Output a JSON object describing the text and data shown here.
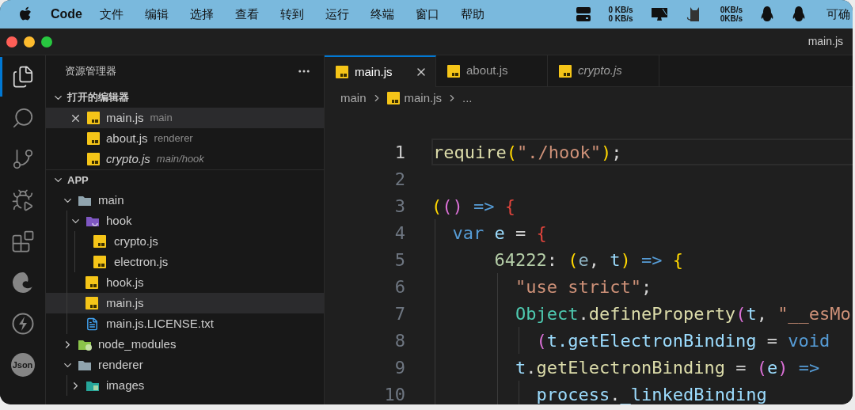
{
  "menu_bar": {
    "app_name": "Code",
    "menus": [
      "文件",
      "编辑",
      "选择",
      "查看",
      "转到",
      "运行",
      "终端",
      "窗口",
      "帮助"
    ],
    "status_items": [
      {
        "kind": "drive"
      },
      {
        "kind": "speed",
        "lines": [
          "0 KB/s",
          "0 KB/s"
        ]
      },
      {
        "kind": "monitor"
      },
      {
        "kind": "cat"
      },
      {
        "kind": "speed",
        "lines": [
          "0KB/s",
          "0KB/s"
        ]
      },
      {
        "kind": "penguin"
      },
      {
        "kind": "penguin"
      }
    ],
    "trailing_text": "可确"
  },
  "window": {
    "title": "main.js"
  },
  "activity_bar": [
    {
      "kind": "explorer",
      "selected": true
    },
    {
      "kind": "search",
      "selected": false
    },
    {
      "kind": "source-control",
      "selected": false
    },
    {
      "kind": "run-debug",
      "selected": false
    },
    {
      "kind": "extensions",
      "selected": false
    },
    {
      "kind": "browser",
      "selected": false
    },
    {
      "kind": "lightning",
      "selected": false
    },
    {
      "kind": "json",
      "label": "Json",
      "selected": false
    }
  ],
  "sidebar": {
    "title": "资源管理器",
    "open_editors": {
      "title": "打开的编辑器",
      "expanded": true,
      "items": [
        {
          "name": "main.js",
          "description": "main",
          "kind": "js",
          "selected": true,
          "preview": false
        },
        {
          "name": "about.js",
          "description": "renderer",
          "kind": "js",
          "selected": false,
          "preview": false
        },
        {
          "name": "crypto.js",
          "description": "main/hook",
          "kind": "js",
          "selected": false,
          "preview": true
        }
      ]
    },
    "folder": {
      "title": "APP",
      "expanded": true,
      "tree": [
        {
          "name": "main",
          "kind": "folder",
          "expanded": true,
          "selected": false,
          "children": [
            {
              "name": "hook",
              "kind": "hook-folder",
              "expanded": true,
              "selected": false,
              "children": [
                {
                  "name": "crypto.js",
                  "kind": "js",
                  "selected": false
                },
                {
                  "name": "electron.js",
                  "kind": "js",
                  "selected": false
                }
              ]
            },
            {
              "name": "hook.js",
              "kind": "js",
              "selected": false
            },
            {
              "name": "main.js",
              "kind": "js",
              "selected": true
            },
            {
              "name": "main.js.LICENSE.txt",
              "kind": "txt",
              "selected": false
            }
          ]
        },
        {
          "name": "node_modules",
          "kind": "node-folder",
          "expanded": false,
          "selected": false
        },
        {
          "name": "renderer",
          "kind": "folder",
          "expanded": true,
          "selected": false,
          "children": [
            {
              "name": "images",
              "kind": "images-folder",
              "expanded": false,
              "selected": false
            }
          ]
        }
      ]
    }
  },
  "tabs": [
    {
      "label": "main.js",
      "selected": true,
      "preview": false
    },
    {
      "label": "about.js",
      "selected": false,
      "preview": false
    },
    {
      "label": "crypto.js",
      "selected": false,
      "preview": true
    }
  ],
  "breadcrumb": [
    {
      "label": "main",
      "kind": "folder"
    },
    {
      "label": "main.js",
      "kind": "js"
    },
    {
      "label": "...",
      "kind": "more"
    }
  ],
  "editor": {
    "lines": [
      {
        "number": "1",
        "current": true,
        "tokens": [
          {
            "kind": "function",
            "text": "require"
          },
          {
            "kind": "bracket1",
            "text": "("
          },
          {
            "kind": "string",
            "text": "\"./hook\""
          },
          {
            "kind": "bracket1",
            "text": ")"
          },
          {
            "kind": "plain",
            "text": ";"
          }
        ]
      },
      {
        "number": "2",
        "current": false
      },
      {
        "number": "3",
        "current": false,
        "tokens": [
          {
            "kind": "bracket1",
            "text": "("
          },
          {
            "kind": "bracket2",
            "text": "()"
          },
          {
            "kind": "keyword",
            "text": " =>"
          },
          {
            "kind": "bracket3",
            "text": " {"
          }
        ]
      },
      {
        "number": "4",
        "current": false,
        "tokens": [
          {
            "kind": "keyword",
            "text": "  var"
          },
          {
            "kind": "variable",
            "text": " e"
          },
          {
            "kind": "plain",
            "text": " = "
          },
          {
            "kind": "bracket3",
            "text": "{"
          }
        ]
      },
      {
        "number": "5",
        "current": false,
        "tokens": [
          {
            "kind": "number",
            "text": "      64222"
          },
          {
            "kind": "plain",
            "text": ": "
          },
          {
            "kind": "bracket1",
            "text": "("
          },
          {
            "kind": "param",
            "text": "e"
          },
          {
            "kind": "plain",
            "text": ", "
          },
          {
            "kind": "variable",
            "text": "t"
          },
          {
            "kind": "bracket1",
            "text": ")"
          },
          {
            "kind": "keyword",
            "text": " =>"
          },
          {
            "kind": "bracket1",
            "text": " {"
          }
        ]
      },
      {
        "number": "6",
        "current": false,
        "tokens": [
          {
            "kind": "string",
            "text": "        \"use strict\""
          },
          {
            "kind": "plain",
            "text": ";"
          }
        ]
      },
      {
        "number": "7",
        "current": false,
        "tokens": [
          {
            "kind": "class",
            "text": "        Object"
          },
          {
            "kind": "plain",
            "text": "."
          },
          {
            "kind": "function",
            "text": "defineProperty"
          },
          {
            "kind": "bracket2",
            "text": "("
          },
          {
            "kind": "variable",
            "text": "t"
          },
          {
            "kind": "plain",
            "text": ", "
          },
          {
            "kind": "string",
            "text": "\"__esMo"
          }
        ]
      },
      {
        "number": "8",
        "current": false,
        "tokens": [
          {
            "kind": "bracket2",
            "text": "          ("
          },
          {
            "kind": "variable",
            "text": "t.getElectronBinding"
          },
          {
            "kind": "plain",
            "text": " = "
          },
          {
            "kind": "keyword",
            "text": "void"
          }
        ]
      },
      {
        "number": "9",
        "current": false,
        "tokens": [
          {
            "kind": "variable",
            "text": "        t"
          },
          {
            "kind": "plain",
            "text": "."
          },
          {
            "kind": "function",
            "text": "getElectronBinding"
          },
          {
            "kind": "plain",
            "text": " = "
          },
          {
            "kind": "bracket2",
            "text": "("
          },
          {
            "kind": "variable",
            "text": "e"
          },
          {
            "kind": "bracket2",
            "text": ")"
          },
          {
            "kind": "keyword",
            "text": " =>"
          }
        ]
      },
      {
        "number": "10",
        "current": false,
        "tokens": [
          {
            "kind": "variable",
            "text": "          process"
          },
          {
            "kind": "plain",
            "text": "."
          },
          {
            "kind": "variable",
            "text": "_linkedBinding"
          }
        ]
      }
    ]
  }
}
